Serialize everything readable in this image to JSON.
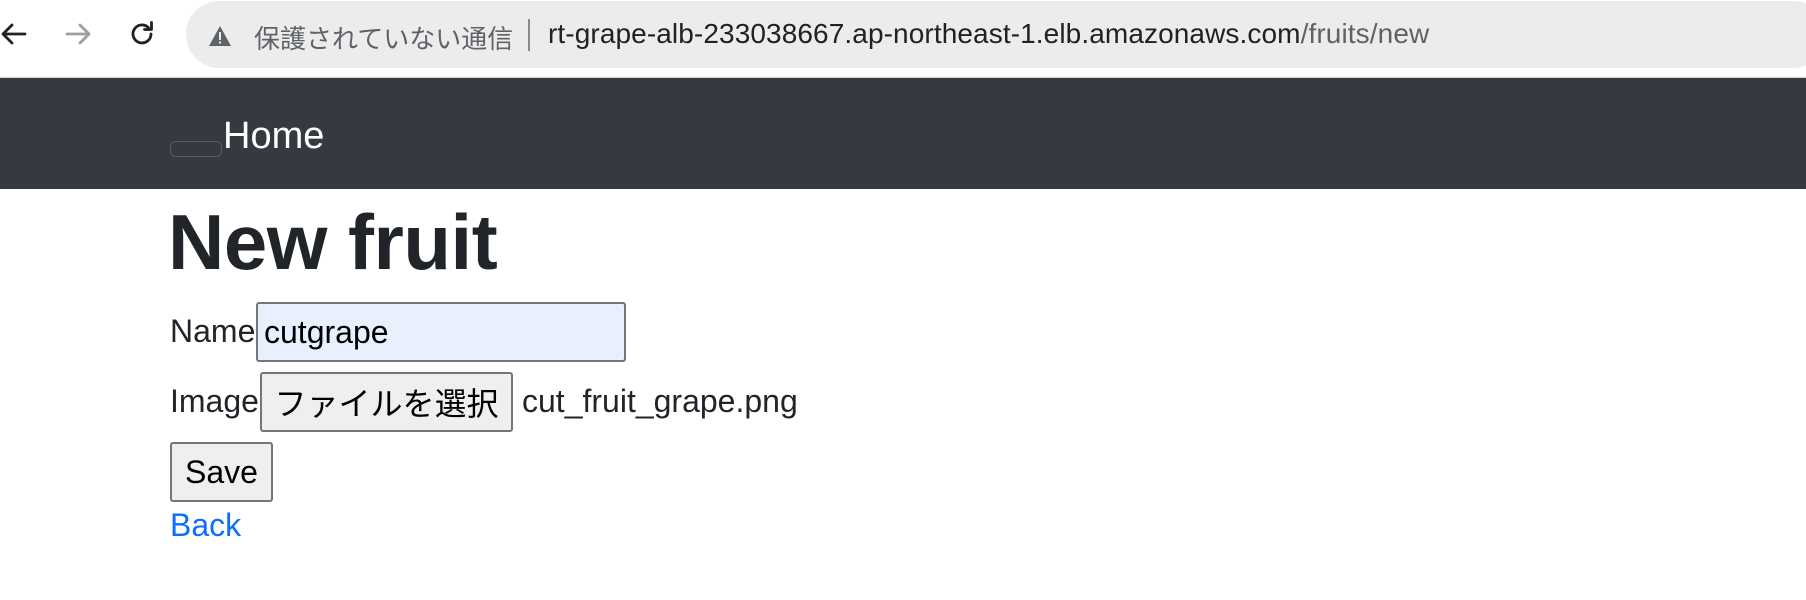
{
  "browser": {
    "security_label": "保護されていない通信",
    "url_host": "rt-grape-alb-233038667.ap-northeast-1.elb.amazonaws.com",
    "url_path": "/fruits/new",
    "icons": [
      "back-arrow-icon",
      "forward-arrow-icon",
      "reload-icon",
      "warning-icon"
    ]
  },
  "navbar": {
    "home_label": "Home",
    "background": "#343a40"
  },
  "main": {
    "title": "New fruit",
    "name_label": "Name",
    "name_value": "cutgrape",
    "image_label": "Image",
    "file_button_label": "ファイルを選択",
    "file_name": "cut_fruit_grape.png",
    "save_label": "Save",
    "back_label": "Back",
    "link_color": "#0d6efd"
  }
}
